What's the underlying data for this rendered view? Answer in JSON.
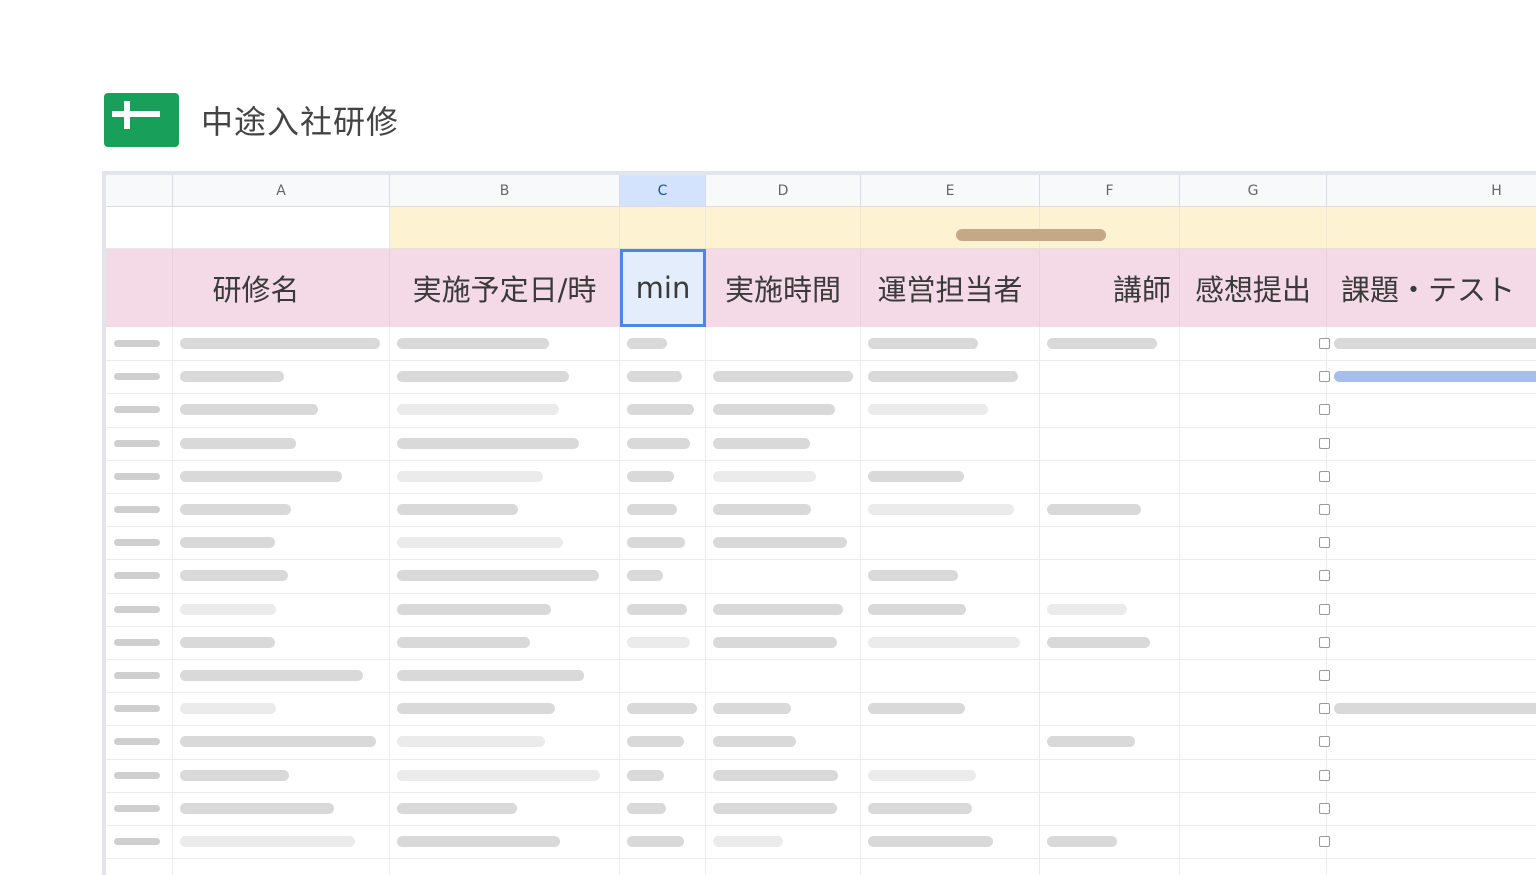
{
  "app": {
    "title": "中途入社研修",
    "icon": "spreadsheet-logo-icon"
  },
  "sheet": {
    "column_letters": [
      "A",
      "B",
      "C",
      "D",
      "E",
      "F",
      "G",
      "H"
    ],
    "selected_column": "C",
    "header_row": [
      "研修名",
      "実施予定日/時",
      "min",
      "実施時間",
      "運営担当者",
      "講師",
      "感想提出",
      "課題・テスト"
    ],
    "checkbox_column": "G",
    "row_count": 16,
    "colors": {
      "accent": "#4a86e8",
      "header_band": "#f4dae7",
      "top_band": "#fdf3d3",
      "logo": "#18a05a"
    }
  }
}
